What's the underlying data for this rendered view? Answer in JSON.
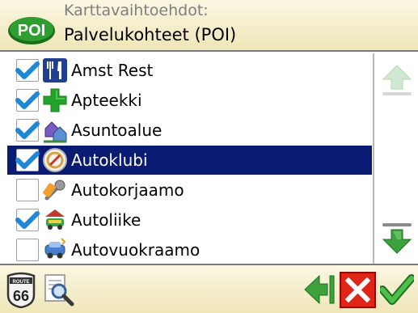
{
  "header": {
    "subtitle": "Karttavaihtoehdot:",
    "title": "Palvelukohteet (POI)",
    "logo_text": "POI"
  },
  "list": {
    "items": [
      {
        "label": "Amst Rest",
        "checked": true,
        "icon": "restaurant-icon"
      },
      {
        "label": "Apteekki",
        "checked": true,
        "icon": "pharmacy-cross-icon"
      },
      {
        "label": "Asuntoalue",
        "checked": true,
        "icon": "residential-area-icon"
      },
      {
        "label": "Autoklubi",
        "checked": true,
        "icon": "auto-club-icon",
        "selected": true
      },
      {
        "label": "Autokorjaamo",
        "checked": false,
        "icon": "car-repair-icon"
      },
      {
        "label": "Autoliike",
        "checked": true,
        "icon": "car-dealer-icon"
      },
      {
        "label": "Autovuokraamo",
        "checked": false,
        "icon": "car-rental-icon"
      }
    ]
  },
  "footer": {
    "route_sign_text": "66",
    "route_sign_label": "ROUTE"
  },
  "colors": {
    "header_bg": "#f4eecd",
    "selection": "#0a1b74",
    "check": "#1e88d6",
    "arrow_green": "#2e9b2e",
    "cancel_red": "#e02418"
  }
}
